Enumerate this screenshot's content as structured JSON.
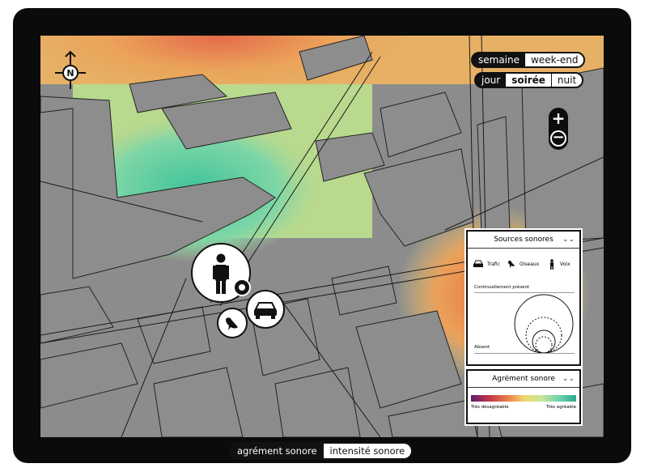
{
  "time_period": {
    "options": [
      "semaine",
      "week-end"
    ],
    "selected": "semaine"
  },
  "time_of_day": {
    "options": [
      "jour",
      "soirée",
      "nuit"
    ],
    "selected": "jour"
  },
  "compass": {
    "label": "N"
  },
  "zoom": {
    "in_label": "+",
    "out_label": "−"
  },
  "sources_panel": {
    "title": "Sources sonores",
    "sources": [
      {
        "label": "Trafic",
        "icon": "car-icon"
      },
      {
        "label": "Oiseaux",
        "icon": "bird-icon"
      },
      {
        "label": "Voix",
        "icon": "person-icon"
      }
    ],
    "top_label": "Continuellement présent",
    "bottom_label": "Absent"
  },
  "agrement_panel": {
    "title": "Agrément sonore",
    "left_label": "Très désagréable",
    "right_label": "Très agréable",
    "gradient_colors": [
      "#5a1e6e",
      "#c0354c",
      "#e8764a",
      "#f2d36e",
      "#c9e89a",
      "#6fd3b0",
      "#2aa88e"
    ]
  },
  "map_markers": [
    {
      "name": "person-icon"
    },
    {
      "name": "car-icon"
    },
    {
      "name": "bird-icon"
    },
    {
      "name": "location-pin-icon"
    }
  ],
  "bottom_tabs": {
    "options": [
      "agrément sonore",
      "intensité sonore"
    ],
    "selected": "agrément sonore"
  }
}
